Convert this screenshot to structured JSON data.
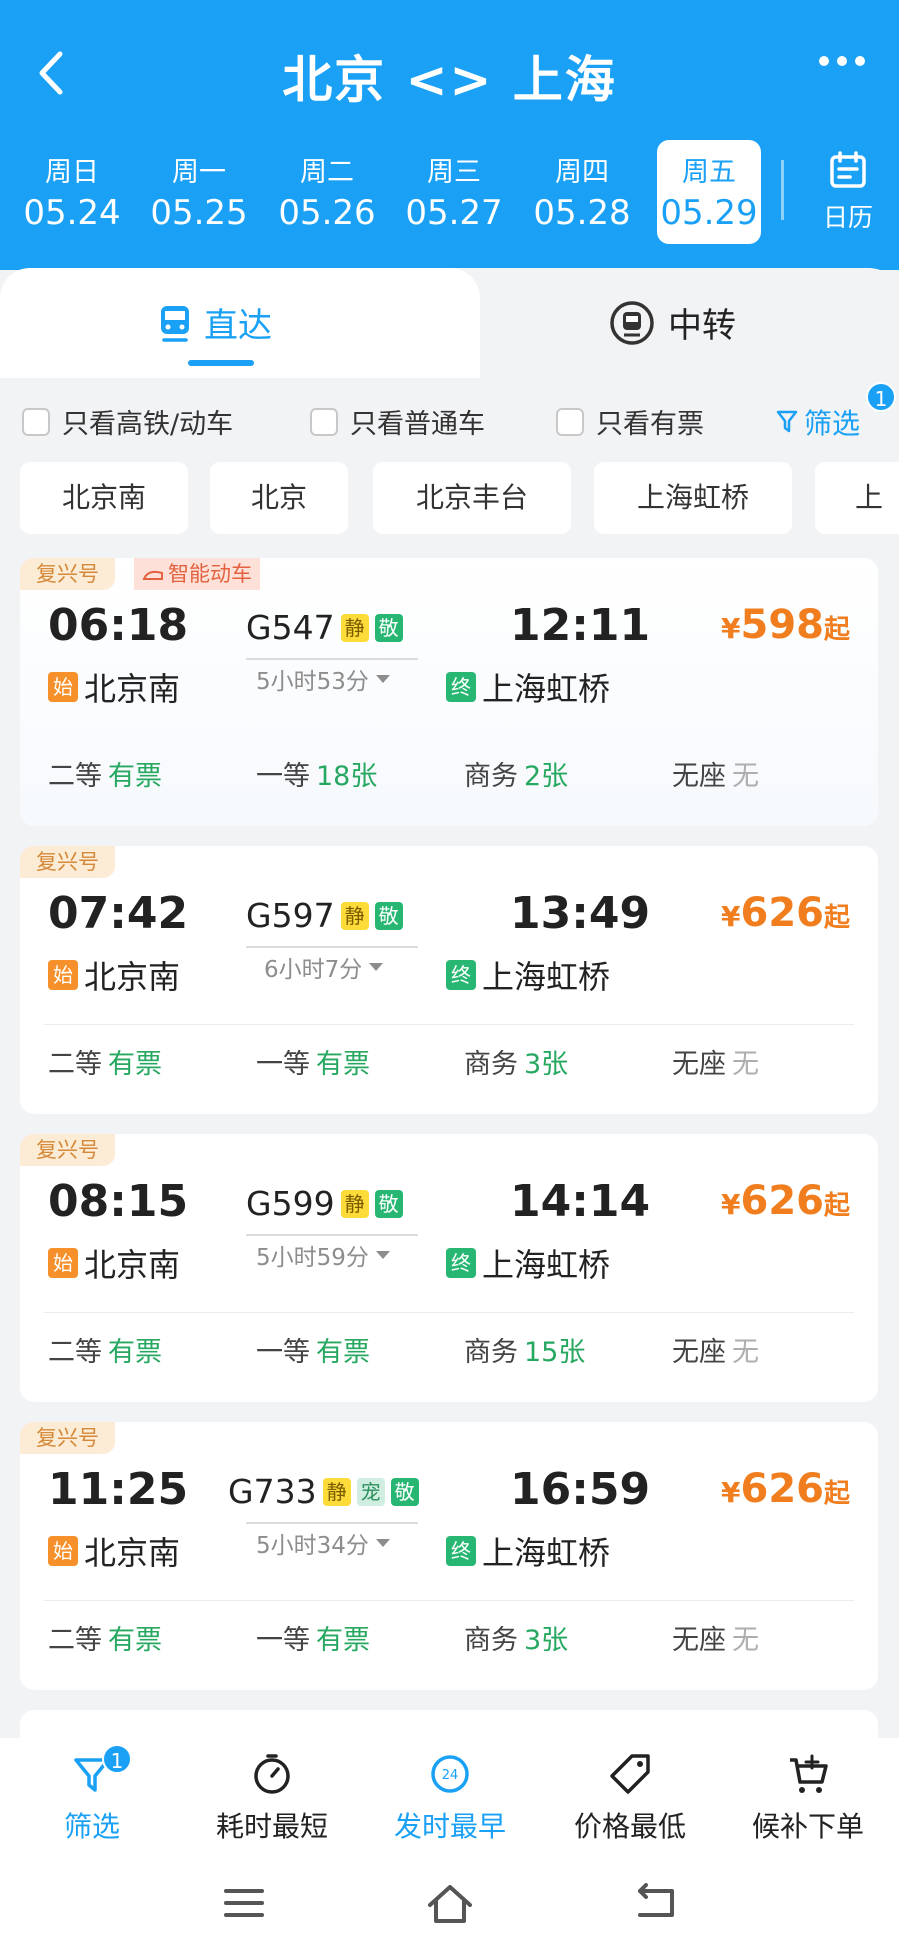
{
  "header": {
    "title": "北京 <> 上海"
  },
  "dates": [
    {
      "weekday": "周日",
      "date": "05.24"
    },
    {
      "weekday": "周一",
      "date": "05.25"
    },
    {
      "weekday": "周二",
      "date": "05.26"
    },
    {
      "weekday": "周三",
      "date": "05.27"
    },
    {
      "weekday": "周四",
      "date": "05.28"
    },
    {
      "weekday": "周五",
      "date": "05.29"
    }
  ],
  "calendar_label": "日历",
  "tabs": {
    "direct": "直达",
    "transfer": "中转"
  },
  "filters": {
    "high_speed": "只看高铁/动车",
    "normal": "只看普通车",
    "available": "只看有票",
    "filter_label": "筛选",
    "filter_count": "1"
  },
  "stations": [
    "北京南",
    "北京",
    "北京丰台",
    "上海虹桥",
    "上"
  ],
  "trains": [
    {
      "tag": "复兴号",
      "tag2": "智能动车",
      "dep_time": "06:18",
      "train_no": "G547",
      "chips": [
        "静",
        "敬"
      ],
      "arr_time": "12:11",
      "duration": "5小时53分",
      "dep_station_mark": "始",
      "dep_station": "北京南",
      "arr_station_mark": "终",
      "arr_station": "上海虹桥",
      "price_symbol": "¥",
      "price": "598",
      "price_suffix": "起",
      "seats": [
        {
          "name": "二等",
          "value": "有票"
        },
        {
          "name": "一等",
          "value": "18张"
        },
        {
          "name": "商务",
          "value": "2张"
        },
        {
          "name": "无座",
          "value": "无"
        }
      ]
    },
    {
      "tag": "复兴号",
      "tag2": "",
      "dep_time": "07:42",
      "train_no": "G597",
      "chips": [
        "静",
        "敬"
      ],
      "arr_time": "13:49",
      "duration": "6小时7分",
      "dep_station_mark": "始",
      "dep_station": "北京南",
      "arr_station_mark": "终",
      "arr_station": "上海虹桥",
      "price_symbol": "¥",
      "price": "626",
      "price_suffix": "起",
      "seats": [
        {
          "name": "二等",
          "value": "有票"
        },
        {
          "name": "一等",
          "value": "有票"
        },
        {
          "name": "商务",
          "value": "3张"
        },
        {
          "name": "无座",
          "value": "无"
        }
      ]
    },
    {
      "tag": "复兴号",
      "tag2": "",
      "dep_time": "08:15",
      "train_no": "G599",
      "chips": [
        "静",
        "敬"
      ],
      "arr_time": "14:14",
      "duration": "5小时59分",
      "dep_station_mark": "始",
      "dep_station": "北京南",
      "arr_station_mark": "终",
      "arr_station": "上海虹桥",
      "price_symbol": "¥",
      "price": "626",
      "price_suffix": "起",
      "seats": [
        {
          "name": "二等",
          "value": "有票"
        },
        {
          "name": "一等",
          "value": "有票"
        },
        {
          "name": "商务",
          "value": "15张"
        },
        {
          "name": "无座",
          "value": "无"
        }
      ]
    },
    {
      "tag": "复兴号",
      "tag2": "",
      "dep_time": "11:25",
      "train_no": "G733",
      "chips": [
        "静",
        "宠",
        "敬"
      ],
      "arr_time": "16:59",
      "duration": "5小时34分",
      "dep_station_mark": "始",
      "dep_station": "北京南",
      "arr_station_mark": "终",
      "arr_station": "上海虹桥",
      "price_symbol": "¥",
      "price": "626",
      "price_suffix": "起",
      "seats": [
        {
          "name": "二等",
          "value": "有票"
        },
        {
          "name": "一等",
          "value": "有票"
        },
        {
          "name": "商务",
          "value": "3张"
        },
        {
          "name": "无座",
          "value": "无"
        }
      ]
    }
  ],
  "bottom_bar": {
    "filter": "筛选",
    "filter_count": "1",
    "shortest": "耗时最短",
    "earliest": "发时最早",
    "earliest_icon_text": "24",
    "cheapest": "价格最低",
    "waitlist": "候补下单"
  },
  "colors": {
    "brand": "#1aa1f5",
    "price": "#f07e1f",
    "available": "#27a861"
  }
}
